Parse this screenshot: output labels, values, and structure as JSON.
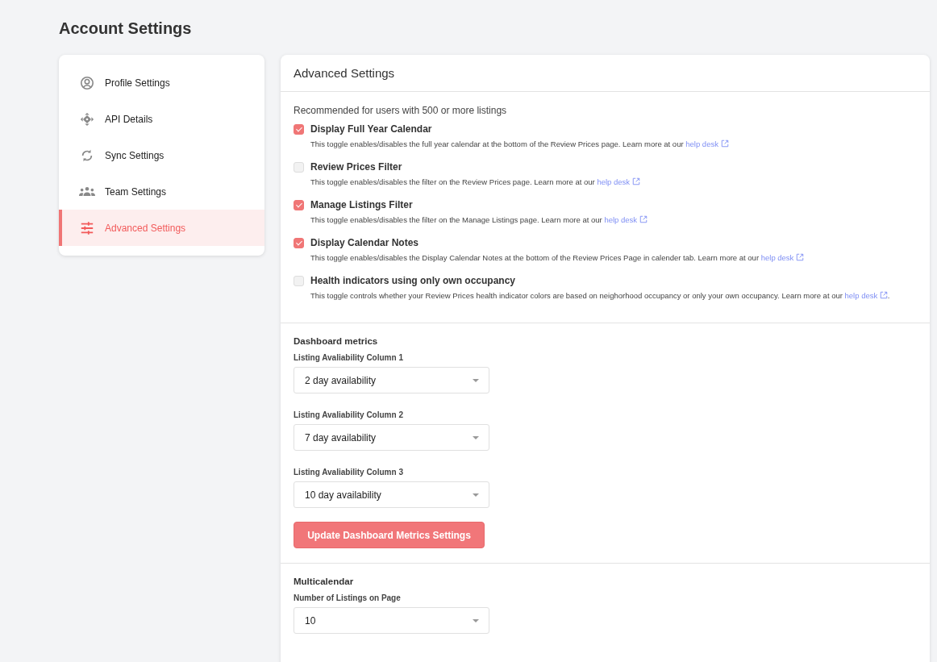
{
  "page_title": "Account Settings",
  "sidebar": {
    "items": [
      {
        "kind": "profile",
        "label": "Profile Settings",
        "selected": false
      },
      {
        "kind": "api",
        "label": "API Details",
        "selected": false
      },
      {
        "kind": "sync",
        "label": "Sync Settings",
        "selected": false
      },
      {
        "kind": "team",
        "label": "Team Settings",
        "selected": false
      },
      {
        "kind": "sliders",
        "label": "Advanced Settings",
        "selected": true
      }
    ]
  },
  "panel": {
    "title": "Advanced Settings",
    "intro": "Recommended for users with 500 or more listings",
    "toggles": [
      {
        "label": "Display Full Year Calendar",
        "checked": true,
        "description": "This toggle enables/disables the full year calendar at the bottom of the Review Prices page. Learn more at our",
        "link": "help desk"
      },
      {
        "label": "Review Prices Filter",
        "checked": false,
        "description": "This toggle enables/disables the filter on the Review Prices page. Learn more at our",
        "link": "help desk"
      },
      {
        "label": "Manage Listings Filter",
        "checked": true,
        "description": "This toggle enables/disables the filter on the Manage Listings page. Learn more at our",
        "link": "help desk"
      },
      {
        "label": "Display Calendar Notes",
        "checked": true,
        "description": "This toggle enables/disables the Display Calendar Notes at the bottom of the Review Prices Page in calender tab. Learn more at our",
        "link": "help desk"
      },
      {
        "label": "Health indicators using only own occupancy",
        "checked": false,
        "description": "This toggle controls whether your Review Prices health indicator colors are based on neighorhood occupancy or only your own occupancy. Learn more at our",
        "link": "help desk",
        "suffix": "."
      }
    ],
    "dashboard": {
      "title": "Dashboard metrics",
      "selects": [
        {
          "label": "Listing Avaliability Column 1",
          "value": "2 day availability"
        },
        {
          "label": "Listing Avaliability Column 2",
          "value": "7 day availability"
        },
        {
          "label": "Listing Avaliability Column 3",
          "value": "10 day availability"
        }
      ],
      "button": "Update Dashboard Metrics Settings"
    },
    "multicalendar": {
      "title": "Multicalendar",
      "selects": [
        {
          "label": "Number of Listings on Page",
          "value": "10"
        }
      ]
    }
  }
}
